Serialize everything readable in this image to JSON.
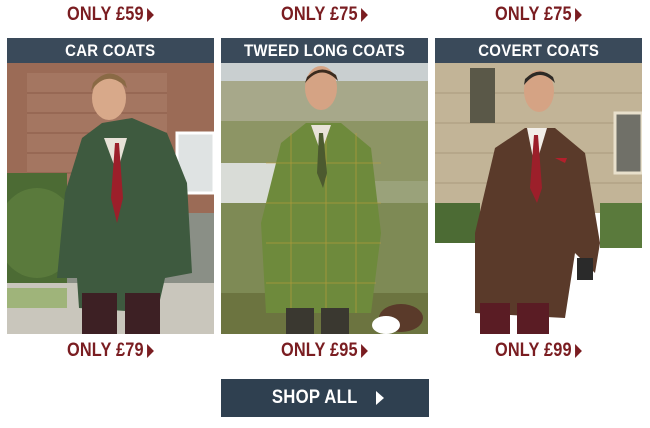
{
  "top_prices": [
    {
      "label": "ONLY £59"
    },
    {
      "label": "ONLY £75"
    },
    {
      "label": "ONLY £75"
    }
  ],
  "products": [
    {
      "title": "CAR COATS",
      "price": "ONLY £79",
      "image": "man-in-green-car-coat-photo"
    },
    {
      "title": "TWEED LONG COATS",
      "price": "ONLY £95",
      "image": "man-in-tweed-long-coat-with-dog-photo"
    },
    {
      "title": "COVERT COATS",
      "price": "ONLY £99",
      "image": "man-in-brown-covert-coat-photo"
    }
  ],
  "shop_all": {
    "label": "SHOP ALL",
    "icon": "chevron-right-icon"
  },
  "colors": {
    "price": "#7a1d21",
    "header_bg": "#3a4a5a",
    "button_bg": "#2f4050"
  }
}
